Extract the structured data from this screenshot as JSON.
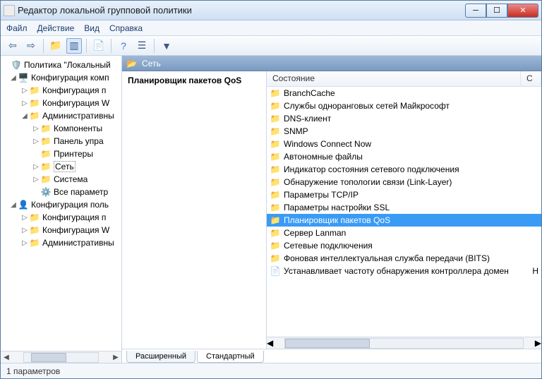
{
  "window": {
    "title": "Редактор локальной групповой политики"
  },
  "menu": {
    "file": "Файл",
    "action": "Действие",
    "view": "Вид",
    "help": "Справка"
  },
  "tree": {
    "root": "Политика \"Локальный",
    "compConfig": "Конфигурация комп",
    "cfgP": "Конфигурация п",
    "cfgW": "Конфигурация W",
    "adminTpl": "Административны",
    "components": "Компоненты",
    "controlPanel": "Панель упра",
    "printers": "Принтеры",
    "network": "Сеть",
    "system": "Система",
    "allParams": "Все параметр",
    "userConfig": "Конфигурация поль",
    "ucfgP": "Конфигурация п",
    "ucfgW": "Конфигурация W",
    "uadmin": "Административны"
  },
  "header": {
    "path": "Сеть"
  },
  "descr": {
    "title": "Планировщик пакетов QoS"
  },
  "columns": {
    "state": "Состояние",
    "c2": "С"
  },
  "list": [
    {
      "label": "BranchCache"
    },
    {
      "label": "Службы одноранговых сетей Майкрософт"
    },
    {
      "label": "DNS-клиент"
    },
    {
      "label": "SNMP"
    },
    {
      "label": "Windows Connect Now"
    },
    {
      "label": "Автономные файлы"
    },
    {
      "label": "Индикатор состояния сетевого подключения"
    },
    {
      "label": "Обнаружение топологии связи (Link-Layer)"
    },
    {
      "label": "Параметры TCP/IP"
    },
    {
      "label": "Параметры настройки SSL"
    },
    {
      "label": "Планировщик пакетов QoS"
    },
    {
      "label": "Сервер Lanman"
    },
    {
      "label": "Сетевые подключения"
    },
    {
      "label": "Фоновая интеллектуальная служба передачи (BITS)"
    },
    {
      "label": "Устанавливает частоту обнаружения контроллера домен",
      "extra": "Н",
      "docIcon": true
    }
  ],
  "selectedIndex": 10,
  "tabs": {
    "extended": "Расширенный",
    "standard": "Стандартный"
  },
  "status": {
    "text": "1 параметров"
  }
}
